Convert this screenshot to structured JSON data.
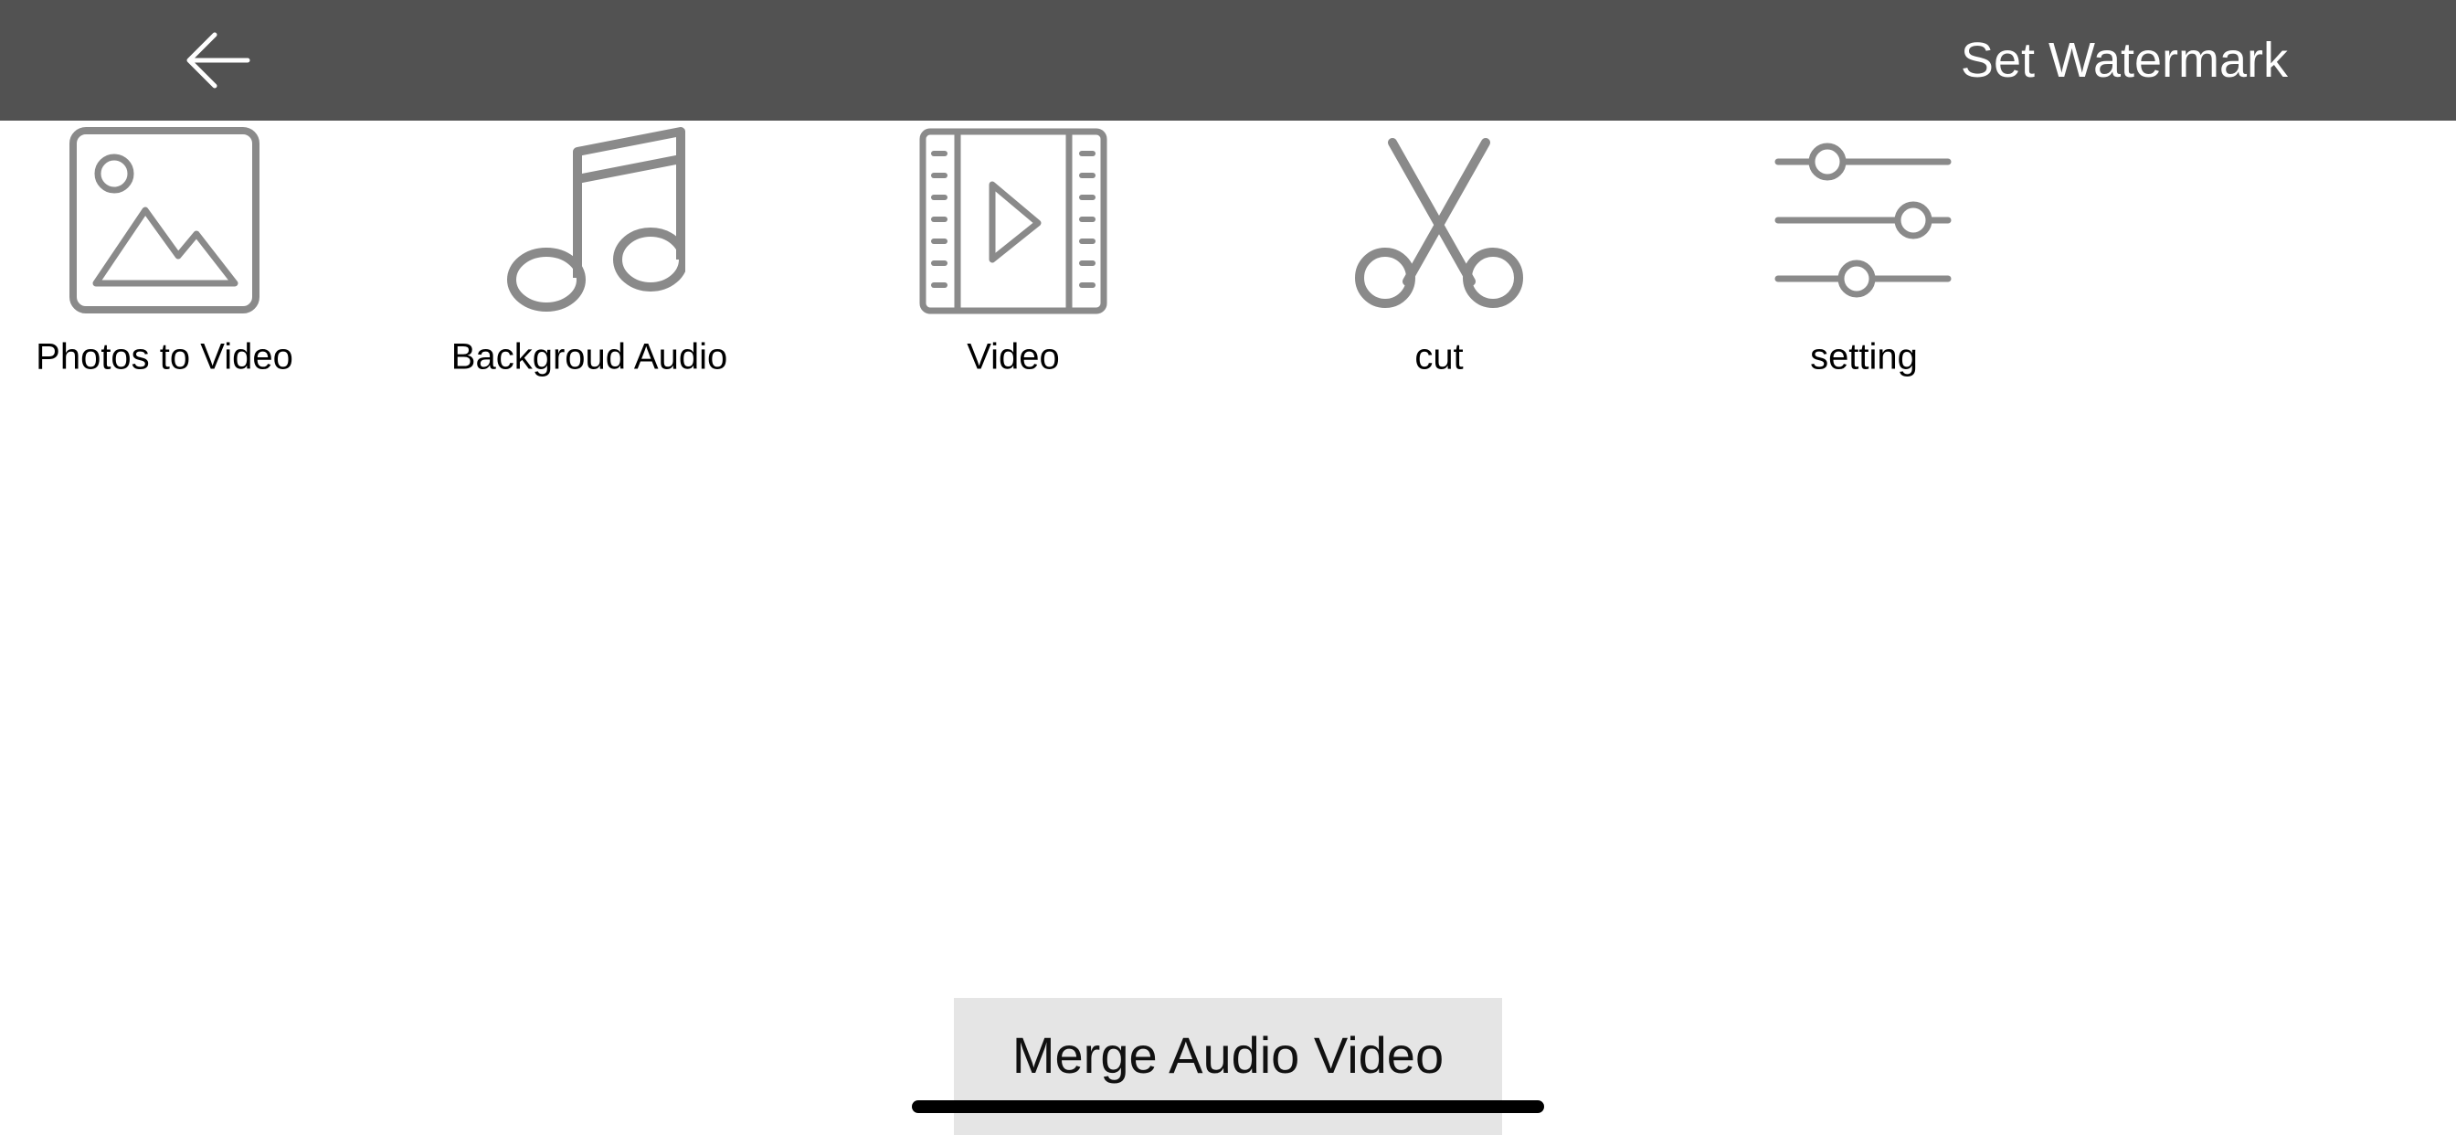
{
  "navbar": {
    "back_icon": "arrow-left-icon",
    "action_label": "Set Watermark",
    "background": "#525252",
    "text_color": "#ffffff"
  },
  "tools": [
    {
      "label": "Photos to Video",
      "icon": "image-icon"
    },
    {
      "label": "Backgroud Audio",
      "icon": "music-note-icon"
    },
    {
      "label": "Video",
      "icon": "film-play-icon"
    },
    {
      "label": "cut",
      "icon": "scissors-icon"
    },
    {
      "label": "setting",
      "icon": "sliders-icon"
    }
  ],
  "icon_color": "#8a8a8a",
  "merge_button": {
    "label": "Merge Audio Video",
    "background": "#e5e5e5"
  }
}
